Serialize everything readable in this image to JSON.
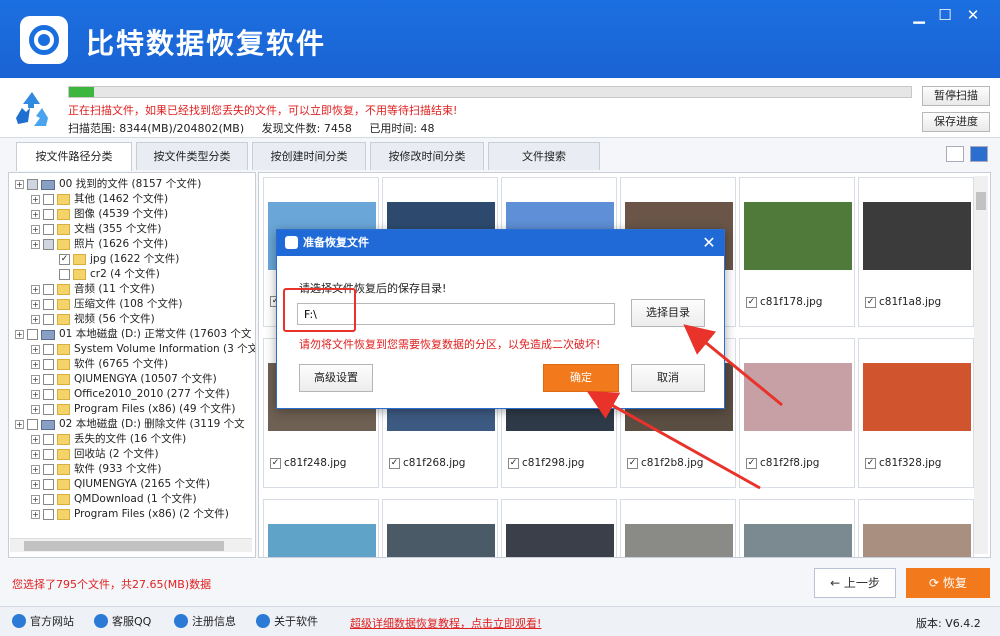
{
  "app": {
    "title": "比特数据恢复软件"
  },
  "window": {
    "minimize": "▁",
    "maximize": "☐",
    "close": "✕"
  },
  "scan": {
    "progress": 0.03,
    "message": "正在扫描文件，如果已经找到您丢失的文件，可以立即恢复，不用等待扫描结束!",
    "range": "扫描范围: 8344(MB)/204802(MB)",
    "found": "发现文件数: 7458",
    "elapsed": "已用时间: 48",
    "pause": "暂停扫描",
    "save": "保存进度"
  },
  "tabs": [
    "按文件路径分类",
    "按文件类型分类",
    "按创建时间分类",
    "按修改时间分类",
    "文件搜索"
  ],
  "tree": [
    {
      "label": "00 找到的文件  (8157 个文件)",
      "level": 0,
      "icon": "drive",
      "check": "part"
    },
    {
      "label": "其他    (1462 个文件)",
      "level": 1,
      "icon": "folder",
      "check": ""
    },
    {
      "label": "图像    (4539 个文件)",
      "level": 1,
      "icon": "folder",
      "check": ""
    },
    {
      "label": "文档    (355 个文件)",
      "level": 1,
      "icon": "folder",
      "check": ""
    },
    {
      "label": "照片    (1626 个文件)",
      "level": 1,
      "icon": "folder",
      "check": "part"
    },
    {
      "label": "jpg    (1622 个文件)",
      "level": 2,
      "icon": "folder",
      "check": "✓"
    },
    {
      "label": "cr2    (4 个文件)",
      "level": 2,
      "icon": "folder",
      "check": ""
    },
    {
      "label": "音频    (11 个文件)",
      "level": 1,
      "icon": "folder",
      "check": ""
    },
    {
      "label": "压缩文件    (108 个文件)",
      "level": 1,
      "icon": "folder",
      "check": ""
    },
    {
      "label": "视频    (56 个文件)",
      "level": 1,
      "icon": "folder",
      "check": ""
    },
    {
      "label": "01 本地磁盘 (D:) 正常文件 (17603 个文",
      "level": 0,
      "icon": "drive",
      "check": ""
    },
    {
      "label": "System Volume Information    (3 个文",
      "level": 1,
      "icon": "folder",
      "check": ""
    },
    {
      "label": "软件    (6765 个文件)",
      "level": 1,
      "icon": "folder",
      "check": ""
    },
    {
      "label": "QIUMENGYA    (10507 个文件)",
      "level": 1,
      "icon": "folder",
      "check": ""
    },
    {
      "label": "Office2010_2010    (277 个文件)",
      "level": 1,
      "icon": "folder",
      "check": ""
    },
    {
      "label": "Program Files (x86)    (49 个文件)",
      "level": 1,
      "icon": "folder",
      "check": ""
    },
    {
      "label": "02 本地磁盘 (D:) 删除文件 (3119 个文",
      "level": 0,
      "icon": "drive",
      "check": ""
    },
    {
      "label": "丢失的文件    (16 个文件)",
      "level": 1,
      "icon": "folder",
      "check": ""
    },
    {
      "label": "回收站    (2 个文件)",
      "level": 1,
      "icon": "folder",
      "check": ""
    },
    {
      "label": "软件    (933 个文件)",
      "level": 1,
      "icon": "folder",
      "check": ""
    },
    {
      "label": "QIUMENGYA    (2165 个文件)",
      "level": 1,
      "icon": "folder",
      "check": ""
    },
    {
      "label": "QMDownload    (1 个文件)",
      "level": 1,
      "icon": "folder",
      "check": ""
    },
    {
      "label": "Program Files (x86)    (2 个文件)",
      "level": 1,
      "icon": "folder",
      "check": ""
    }
  ],
  "files": [
    {
      "name": "",
      "color": "#6aa7d8"
    },
    {
      "name": "",
      "color": "#2d4a6e"
    },
    {
      "name": "",
      "color": "#5f8fd6"
    },
    {
      "name": "",
      "color": "#6a5548"
    },
    {
      "name": "c81f178.jpg",
      "color": "#4f7a3a"
    },
    {
      "name": "c81f1a8.jpg",
      "color": "#3b3b3b"
    },
    {
      "name": "c81f248.jpg",
      "color": "#6e6052"
    },
    {
      "name": "c81f268.jpg",
      "color": "#3d5a82"
    },
    {
      "name": "c81f298.jpg",
      "color": "#2f3a48"
    },
    {
      "name": "c81f2b8.jpg",
      "color": "#5a4e43"
    },
    {
      "name": "c81f2f8.jpg",
      "color": "#c7a0a6"
    },
    {
      "name": "c81f328.jpg",
      "color": "#d0552f"
    },
    {
      "name": "",
      "color": "#5fa3c8"
    },
    {
      "name": "",
      "color": "#4a5a66"
    },
    {
      "name": "",
      "color": "#3a3f4a"
    },
    {
      "name": "",
      "color": "#8a8a86"
    },
    {
      "name": "",
      "color": "#7a8a90"
    },
    {
      "name": "",
      "color": "#a98f80"
    }
  ],
  "status": {
    "selected": "您选择了795个文件，共27.65(MB)数据"
  },
  "nav": {
    "prev": "← 上一步",
    "recover": "恢复"
  },
  "footer": {
    "links": [
      "官方网站",
      "客服QQ",
      "注册信息",
      "关于软件"
    ],
    "promo": "超级详细数据恢复教程，点击立即观看!",
    "version": "版本: V6.4.2"
  },
  "dialog": {
    "title": "准备恢复文件",
    "prompt": "请选择文件恢复后的保存目录!",
    "path": "F:\\",
    "browse": "选择目录",
    "warning": "请勿将文件恢复到您需要恢复数据的分区，以免造成二次破坏!",
    "advanced": "高级设置",
    "ok": "确定",
    "cancel": "取消"
  },
  "colors": {
    "brand": "#1a63d4",
    "accent": "#f27a1c",
    "warning": "#e02020"
  }
}
